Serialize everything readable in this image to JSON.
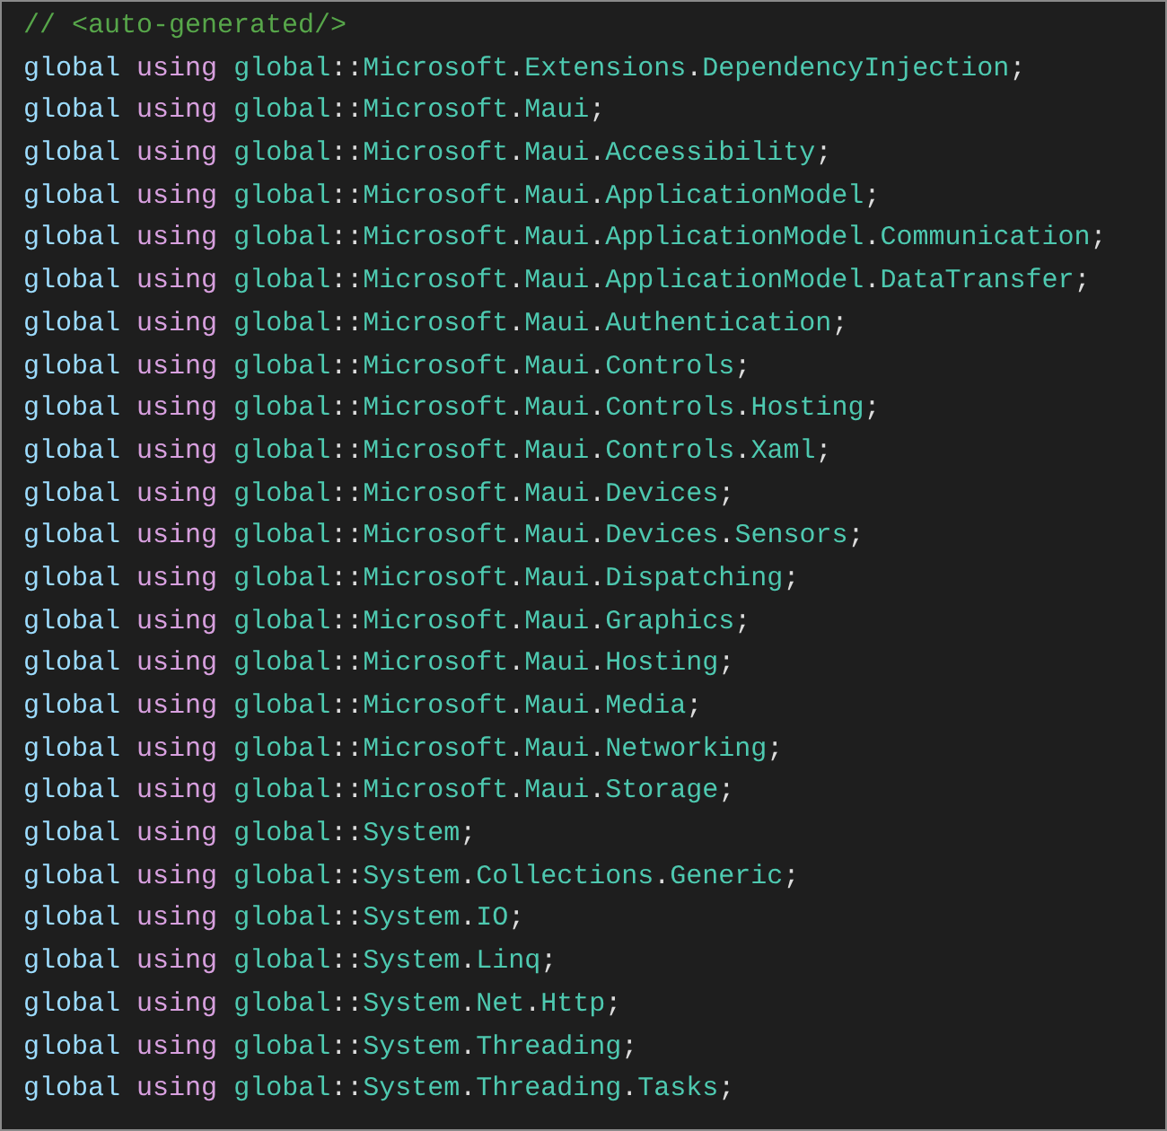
{
  "editor": {
    "lines": [
      {
        "kind": "comment",
        "text": "// <auto-generated/>"
      },
      {
        "kind": "using",
        "modifier": "global",
        "keyword": "using",
        "alias": "global",
        "separator": "::",
        "namespace": "Microsoft.Extensions.DependencyInjection",
        "terminator": ";"
      },
      {
        "kind": "using",
        "modifier": "global",
        "keyword": "using",
        "alias": "global",
        "separator": "::",
        "namespace": "Microsoft.Maui",
        "terminator": ";"
      },
      {
        "kind": "using",
        "modifier": "global",
        "keyword": "using",
        "alias": "global",
        "separator": "::",
        "namespace": "Microsoft.Maui.Accessibility",
        "terminator": ";"
      },
      {
        "kind": "using",
        "modifier": "global",
        "keyword": "using",
        "alias": "global",
        "separator": "::",
        "namespace": "Microsoft.Maui.ApplicationModel",
        "terminator": ";"
      },
      {
        "kind": "using",
        "modifier": "global",
        "keyword": "using",
        "alias": "global",
        "separator": "::",
        "namespace": "Microsoft.Maui.ApplicationModel.Communication",
        "terminator": ";"
      },
      {
        "kind": "using",
        "modifier": "global",
        "keyword": "using",
        "alias": "global",
        "separator": "::",
        "namespace": "Microsoft.Maui.ApplicationModel.DataTransfer",
        "terminator": ";"
      },
      {
        "kind": "using",
        "modifier": "global",
        "keyword": "using",
        "alias": "global",
        "separator": "::",
        "namespace": "Microsoft.Maui.Authentication",
        "terminator": ";"
      },
      {
        "kind": "using",
        "modifier": "global",
        "keyword": "using",
        "alias": "global",
        "separator": "::",
        "namespace": "Microsoft.Maui.Controls",
        "terminator": ";"
      },
      {
        "kind": "using",
        "modifier": "global",
        "keyword": "using",
        "alias": "global",
        "separator": "::",
        "namespace": "Microsoft.Maui.Controls.Hosting",
        "terminator": ";"
      },
      {
        "kind": "using",
        "modifier": "global",
        "keyword": "using",
        "alias": "global",
        "separator": "::",
        "namespace": "Microsoft.Maui.Controls.Xaml",
        "terminator": ";"
      },
      {
        "kind": "using",
        "modifier": "global",
        "keyword": "using",
        "alias": "global",
        "separator": "::",
        "namespace": "Microsoft.Maui.Devices",
        "terminator": ";"
      },
      {
        "kind": "using",
        "modifier": "global",
        "keyword": "using",
        "alias": "global",
        "separator": "::",
        "namespace": "Microsoft.Maui.Devices.Sensors",
        "terminator": ";"
      },
      {
        "kind": "using",
        "modifier": "global",
        "keyword": "using",
        "alias": "global",
        "separator": "::",
        "namespace": "Microsoft.Maui.Dispatching",
        "terminator": ";"
      },
      {
        "kind": "using",
        "modifier": "global",
        "keyword": "using",
        "alias": "global",
        "separator": "::",
        "namespace": "Microsoft.Maui.Graphics",
        "terminator": ";"
      },
      {
        "kind": "using",
        "modifier": "global",
        "keyword": "using",
        "alias": "global",
        "separator": "::",
        "namespace": "Microsoft.Maui.Hosting",
        "terminator": ";"
      },
      {
        "kind": "using",
        "modifier": "global",
        "keyword": "using",
        "alias": "global",
        "separator": "::",
        "namespace": "Microsoft.Maui.Media",
        "terminator": ";"
      },
      {
        "kind": "using",
        "modifier": "global",
        "keyword": "using",
        "alias": "global",
        "separator": "::",
        "namespace": "Microsoft.Maui.Networking",
        "terminator": ";"
      },
      {
        "kind": "using",
        "modifier": "global",
        "keyword": "using",
        "alias": "global",
        "separator": "::",
        "namespace": "Microsoft.Maui.Storage",
        "terminator": ";"
      },
      {
        "kind": "using",
        "modifier": "global",
        "keyword": "using",
        "alias": "global",
        "separator": "::",
        "namespace": "System",
        "terminator": ";"
      },
      {
        "kind": "using",
        "modifier": "global",
        "keyword": "using",
        "alias": "global",
        "separator": "::",
        "namespace": "System.Collections.Generic",
        "terminator": ";"
      },
      {
        "kind": "using",
        "modifier": "global",
        "keyword": "using",
        "alias": "global",
        "separator": "::",
        "namespace": "System.IO",
        "terminator": ";"
      },
      {
        "kind": "using",
        "modifier": "global",
        "keyword": "using",
        "alias": "global",
        "separator": "::",
        "namespace": "System.Linq",
        "terminator": ";"
      },
      {
        "kind": "using",
        "modifier": "global",
        "keyword": "using",
        "alias": "global",
        "separator": "::",
        "namespace": "System.Net.Http",
        "terminator": ";"
      },
      {
        "kind": "using",
        "modifier": "global",
        "keyword": "using",
        "alias": "global",
        "separator": "::",
        "namespace": "System.Threading",
        "terminator": ";"
      },
      {
        "kind": "using",
        "modifier": "global",
        "keyword": "using",
        "alias": "global",
        "separator": "::",
        "namespace": "System.Threading.Tasks",
        "terminator": ";"
      }
    ]
  }
}
